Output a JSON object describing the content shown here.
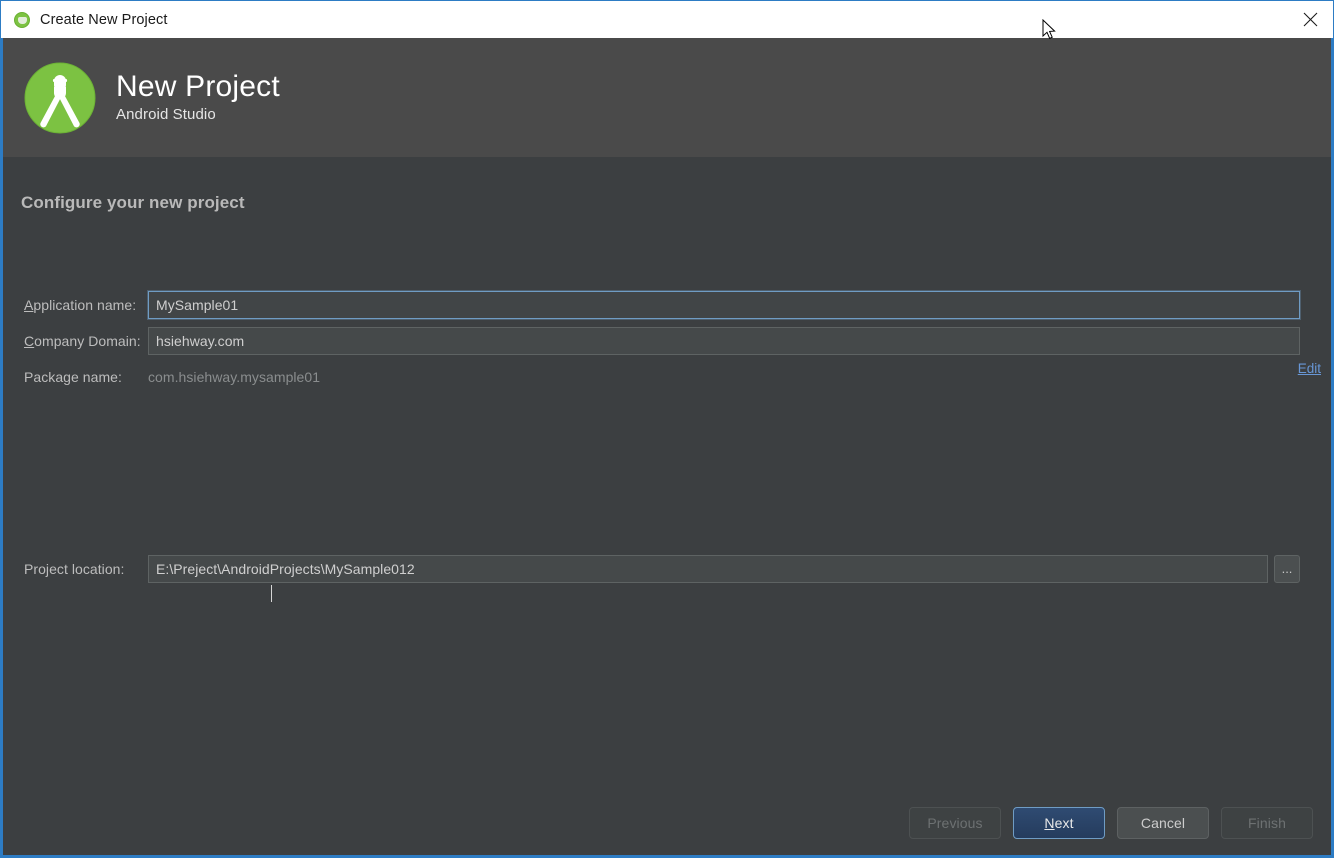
{
  "titlebar": {
    "title": "Create New Project",
    "icon": "android-studio-icon",
    "close_label": "close-icon"
  },
  "header": {
    "title": "New Project",
    "subtitle": "Android Studio",
    "logo": "android-studio-logo"
  },
  "page": {
    "heading": "Configure your new project"
  },
  "form": {
    "application_name": {
      "label_mnemonic": "A",
      "label_rest": "pplication name:",
      "value": "MySample01",
      "placeholder": "Application name"
    },
    "company_domain": {
      "label_mnemonic": "C",
      "label_rest": "ompany Domain:",
      "value": "hsiehway.com",
      "placeholder": "Company domain"
    },
    "package_name": {
      "label": "Package name:",
      "value": "com.hsiehway.mysample01",
      "edit_link": "Edit"
    },
    "project_location": {
      "label": "Project location:",
      "value": "E:\\Preject\\AndroidProjects\\MySample012",
      "placeholder": "Project location",
      "browse_label": "..."
    }
  },
  "footer": {
    "previous": "Previous",
    "next_mnemonic": "N",
    "next_rest": "ext",
    "cancel": "Cancel",
    "finish": "Finish"
  },
  "colors": {
    "window_border": "#2d7cc4",
    "header_band": "#4a4a4a",
    "body_bg": "#3c3f41",
    "accent_green": "#7cc242",
    "link_blue": "#6897d6",
    "primary_button_border": "#6f9cc4"
  }
}
